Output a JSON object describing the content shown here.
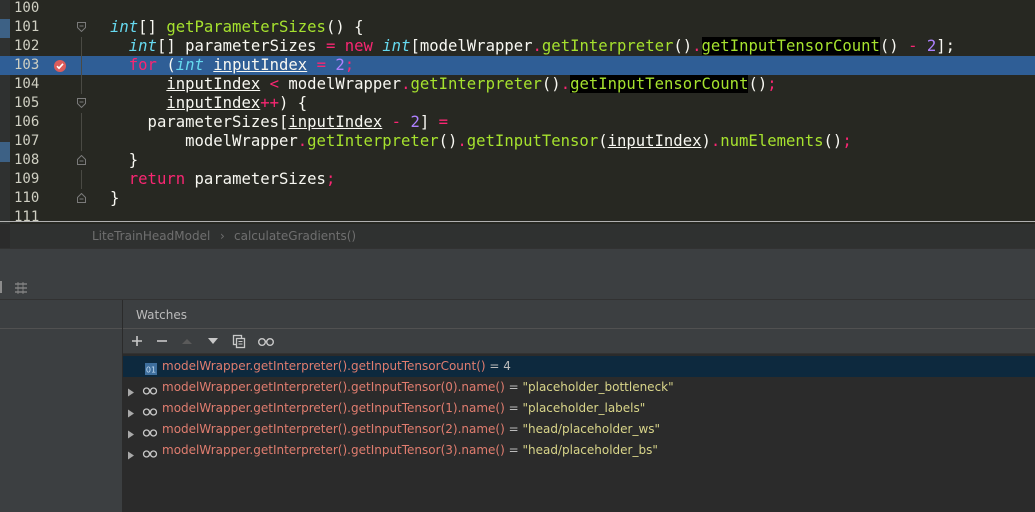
{
  "editor": {
    "lines": [
      {
        "num": "100",
        "tokens": []
      },
      {
        "num": "101",
        "tokens": [
          {
            "t": "int",
            "c": "ty"
          },
          {
            "t": "[] ",
            "c": "pl"
          },
          {
            "t": "getParameterSizes",
            "c": "fn"
          },
          {
            "t": "() {",
            "c": "pl"
          }
        ]
      },
      {
        "num": "102",
        "tokens": [
          {
            "t": "  "
          },
          {
            "t": "int",
            "c": "ty"
          },
          {
            "t": "[] parameterSizes ",
            "c": "pl"
          },
          {
            "t": "=",
            "c": "kw"
          },
          {
            "t": " "
          },
          {
            "t": "new",
            "c": "kw"
          },
          {
            "t": " "
          },
          {
            "t": "int",
            "c": "ty"
          },
          {
            "t": "[modelWrapper",
            "c": "pl"
          },
          {
            "t": ".",
            "c": "kw"
          },
          {
            "t": "getInterpreter",
            "c": "fn"
          },
          {
            "t": "()",
            "c": "pl"
          },
          {
            "t": ".",
            "c": "kw"
          },
          {
            "t": "getInputTensorCount",
            "c": "fn hl"
          },
          {
            "t": "() ",
            "c": "pl"
          },
          {
            "t": "-",
            "c": "kw"
          },
          {
            "t": " "
          },
          {
            "t": "2",
            "c": "num"
          },
          {
            "t": "];",
            "c": "pl"
          }
        ]
      },
      {
        "num": "103",
        "sel": true,
        "tokens": [
          {
            "t": "  "
          },
          {
            "t": "for",
            "c": "kw"
          },
          {
            "t": " (",
            "c": "pl"
          },
          {
            "t": "int",
            "c": "ty"
          },
          {
            "t": " "
          },
          {
            "t": "inputIndex",
            "c": "pl ul"
          },
          {
            "t": " "
          },
          {
            "t": "=",
            "c": "kw"
          },
          {
            "t": " "
          },
          {
            "t": "2",
            "c": "num"
          },
          {
            "t": ";",
            "c": "kw"
          }
        ]
      },
      {
        "num": "104",
        "tokens": [
          {
            "t": "      "
          },
          {
            "t": "inputIndex",
            "c": "pl ul"
          },
          {
            "t": " "
          },
          {
            "t": "<",
            "c": "kw"
          },
          {
            "t": " modelWrapper",
            "c": "pl"
          },
          {
            "t": ".",
            "c": "kw"
          },
          {
            "t": "getInterpreter",
            "c": "fn"
          },
          {
            "t": "()",
            "c": "pl"
          },
          {
            "t": ".",
            "c": "kw"
          },
          {
            "t": "getInputTensorCount",
            "c": "fn hl"
          },
          {
            "t": "()",
            "c": "pl"
          },
          {
            "t": ";",
            "c": "kw"
          }
        ]
      },
      {
        "num": "105",
        "tokens": [
          {
            "t": "      "
          },
          {
            "t": "inputIndex",
            "c": "pl ul"
          },
          {
            "t": "++",
            "c": "kw"
          },
          {
            "t": ") {",
            "c": "pl"
          }
        ]
      },
      {
        "num": "106",
        "tokens": [
          {
            "t": "    parameterSizes[",
            "c": "pl"
          },
          {
            "t": "inputIndex",
            "c": "pl ul"
          },
          {
            "t": " "
          },
          {
            "t": "-",
            "c": "kw"
          },
          {
            "t": " "
          },
          {
            "t": "2",
            "c": "num"
          },
          {
            "t": "] ",
            "c": "pl"
          },
          {
            "t": "=",
            "c": "kw"
          }
        ]
      },
      {
        "num": "107",
        "tokens": [
          {
            "t": "        modelWrapper",
            "c": "pl"
          },
          {
            "t": ".",
            "c": "kw"
          },
          {
            "t": "getInterpreter",
            "c": "fn"
          },
          {
            "t": "()",
            "c": "pl"
          },
          {
            "t": ".",
            "c": "kw"
          },
          {
            "t": "getInputTensor",
            "c": "fn"
          },
          {
            "t": "(",
            "c": "pl"
          },
          {
            "t": "inputIndex",
            "c": "pl ul"
          },
          {
            "t": ")",
            "c": "pl"
          },
          {
            "t": ".",
            "c": "kw"
          },
          {
            "t": "numElements",
            "c": "fn"
          },
          {
            "t": "()",
            "c": "pl"
          },
          {
            "t": ";",
            "c": "kw"
          }
        ]
      },
      {
        "num": "108",
        "tokens": [
          {
            "t": "  }",
            "c": "pl"
          }
        ]
      },
      {
        "num": "109",
        "tokens": [
          {
            "t": "  "
          },
          {
            "t": "return",
            "c": "kw"
          },
          {
            "t": " parameterSizes",
            "c": "pl"
          },
          {
            "t": ";",
            "c": "kw"
          }
        ]
      },
      {
        "num": "110",
        "tokens": [
          {
            "t": "}",
            "c": "pl"
          }
        ]
      },
      {
        "num": "111",
        "tokens": []
      }
    ]
  },
  "breadcrumb": {
    "class_name": "LiteTrainHeadModel",
    "separator": "›",
    "method_name": "calculateGradients()"
  },
  "watches": {
    "title": "Watches",
    "toolbar": [
      "add-icon",
      "remove-icon",
      "move-up-icon",
      "move-down-icon",
      "copy-icon",
      "glasses-icon"
    ],
    "rows": [
      {
        "expr": "modelWrapper.getInterpreter().getInputTensorCount()",
        "value": "4",
        "icon": "primitive-icon",
        "expandable": false,
        "selected": true
      },
      {
        "expr": "modelWrapper.getInterpreter().getInputTensor(0).name()",
        "value": "\"placeholder_bottleneck\"",
        "icon": "watch-icon",
        "expandable": true
      },
      {
        "expr": "modelWrapper.getInterpreter().getInputTensor(1).name()",
        "value": "\"placeholder_labels\"",
        "icon": "watch-icon",
        "expandable": true
      },
      {
        "expr": "modelWrapper.getInterpreter().getInputTensor(2).name()",
        "value": "\"head/placeholder_ws\"",
        "icon": "watch-icon",
        "expandable": true
      },
      {
        "expr": "modelWrapper.getInterpreter().getInputTensor(3).name()",
        "value": "\"head/placeholder_bs\"",
        "icon": "watch-icon",
        "expandable": true
      }
    ]
  },
  "colors": {
    "editor_bg": "#272822",
    "selection": "#2f5e96",
    "keyword": "#f92672",
    "type": "#66d9ef",
    "function": "#a6e22e",
    "number": "#ae81ff",
    "watch_expr": "#e07d6f",
    "watch_value": "#d9d58a"
  }
}
